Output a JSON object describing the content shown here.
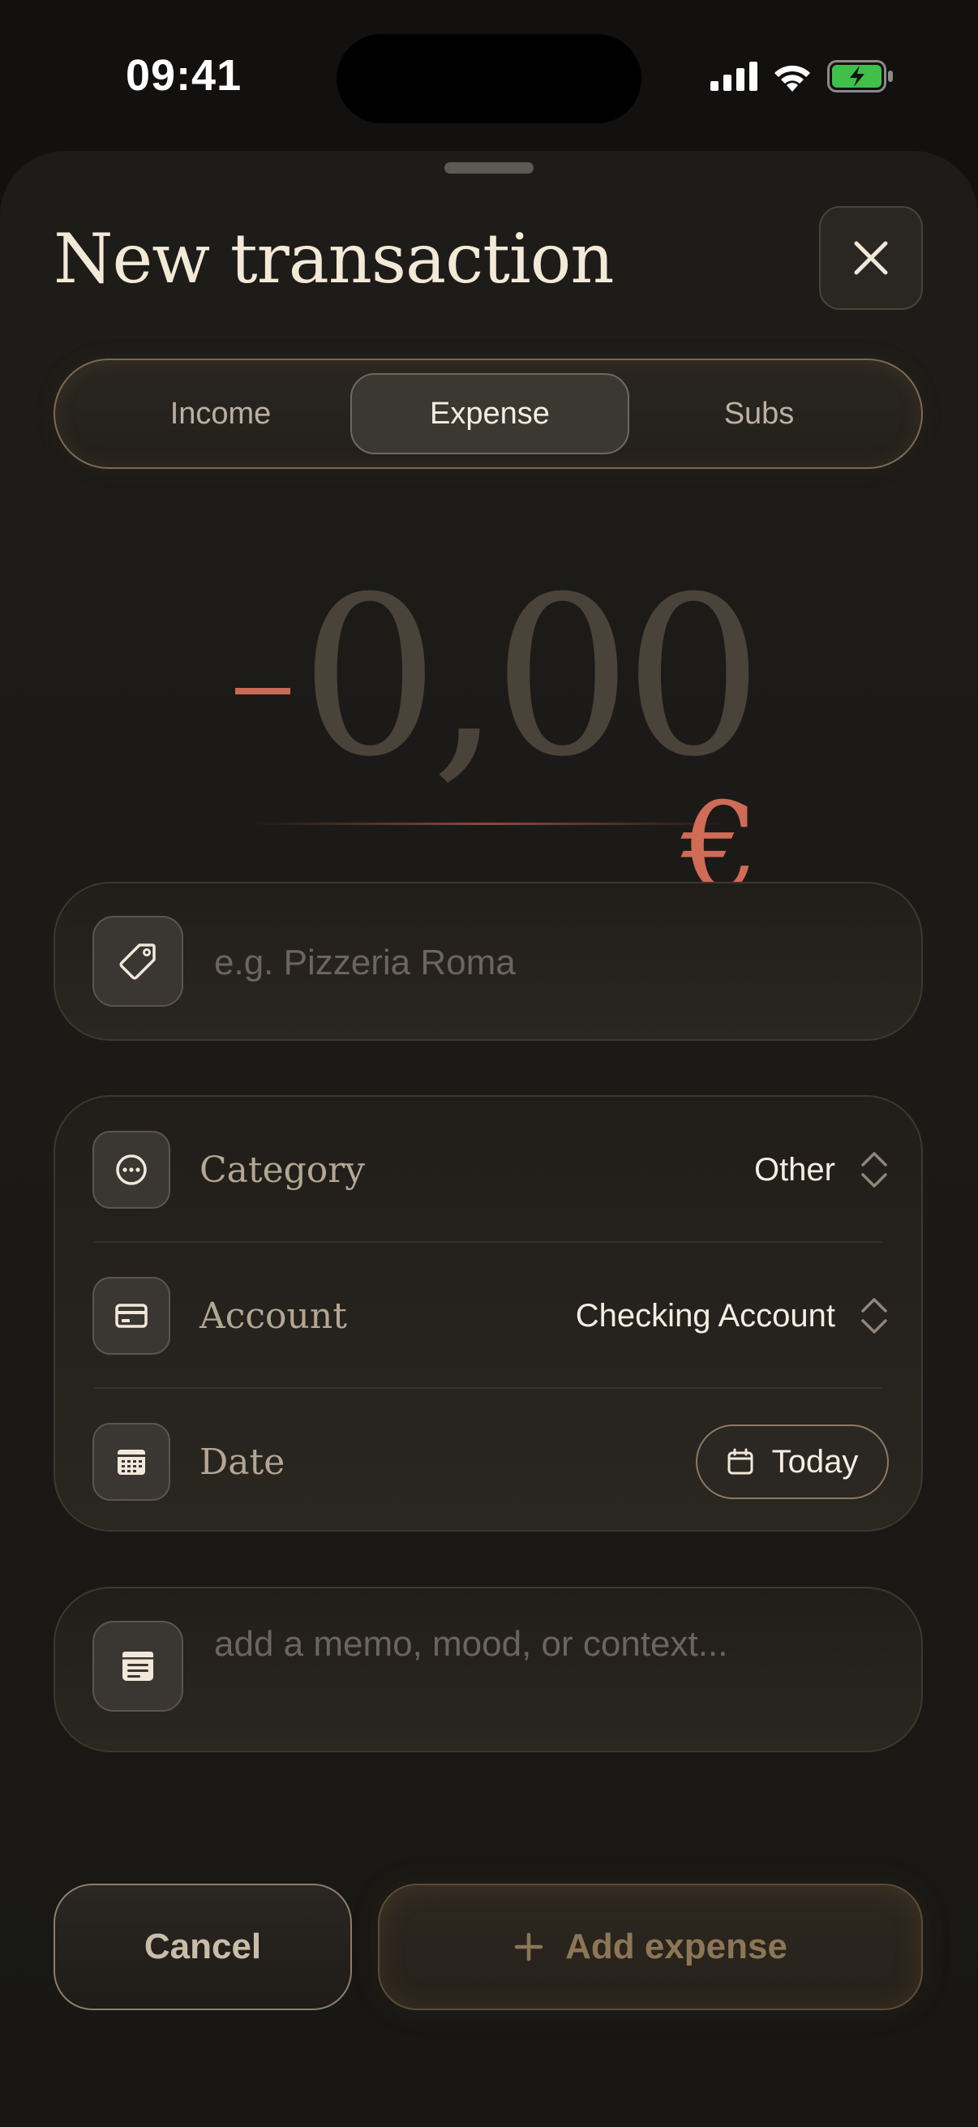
{
  "status_bar": {
    "time": "09:41",
    "icons": [
      "cellular-signal-icon",
      "wifi-icon",
      "battery-charging-icon"
    ]
  },
  "sheet": {
    "title": "New transaction",
    "close_icon": "close-icon"
  },
  "type_segment": {
    "options": [
      "Income",
      "Expense",
      "Subs"
    ],
    "selected": "Expense"
  },
  "amount": {
    "sign": "-",
    "value": "0,00",
    "currency": "€"
  },
  "name_field": {
    "icon": "tag-icon",
    "value": "",
    "placeholder": "e.g. Pizzeria Roma"
  },
  "details": {
    "category": {
      "label": "Category",
      "value": "Other",
      "icon": "more-circle-icon"
    },
    "account": {
      "label": "Account",
      "value": "Checking Account",
      "icon": "credit-card-icon"
    },
    "date": {
      "label": "Date",
      "value": "Today",
      "icon": "calendar-grid-icon"
    }
  },
  "memo_field": {
    "icon": "note-icon",
    "value": "",
    "placeholder": "add a memo, mood, or context..."
  },
  "actions": {
    "cancel_label": "Cancel",
    "add_label": "Add expense"
  },
  "colors": {
    "background": "#121110",
    "sheet": "#1e1c19",
    "accent_expense": "#cf6b56",
    "gold_border": "#8b7a62",
    "battery_green": "#3fc04a"
  }
}
